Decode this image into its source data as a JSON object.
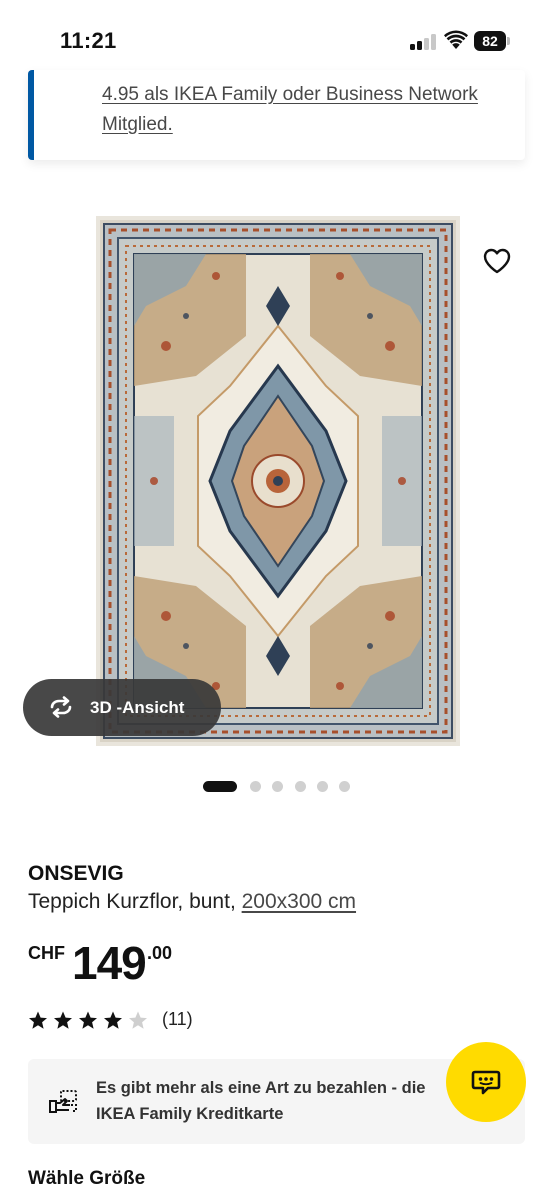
{
  "status_bar": {
    "time": "11:21",
    "battery_level": "82",
    "icons": [
      "signal-icon",
      "wifi-icon",
      "battery-icon"
    ]
  },
  "info_card": {
    "text": "4.95 als IKEA Family oder Business Network Mitglied.",
    "accent_color": "#0058a3"
  },
  "product_image": {
    "icons": [
      "heart-icon"
    ],
    "view_3d_label": "3D -Ansicht",
    "carousel_count": 6,
    "carousel_active_index": 0
  },
  "product": {
    "name": "ONSEVIG",
    "description": "Teppich Kurzflor, bunt, ",
    "size": "200x300 cm",
    "price_currency": "CHF",
    "price_integer": "149",
    "price_decimal": ".00",
    "rating": 4.5,
    "reviews": "(11)"
  },
  "payment_card": {
    "text": "Es gibt mehr als eine Art zu bezahlen - die IKEA Family Kreditkarte"
  },
  "chat_button": {
    "color": "#ffdb00",
    "icon": "chat-icon"
  },
  "size_section": {
    "title": "Wähle Größe"
  }
}
